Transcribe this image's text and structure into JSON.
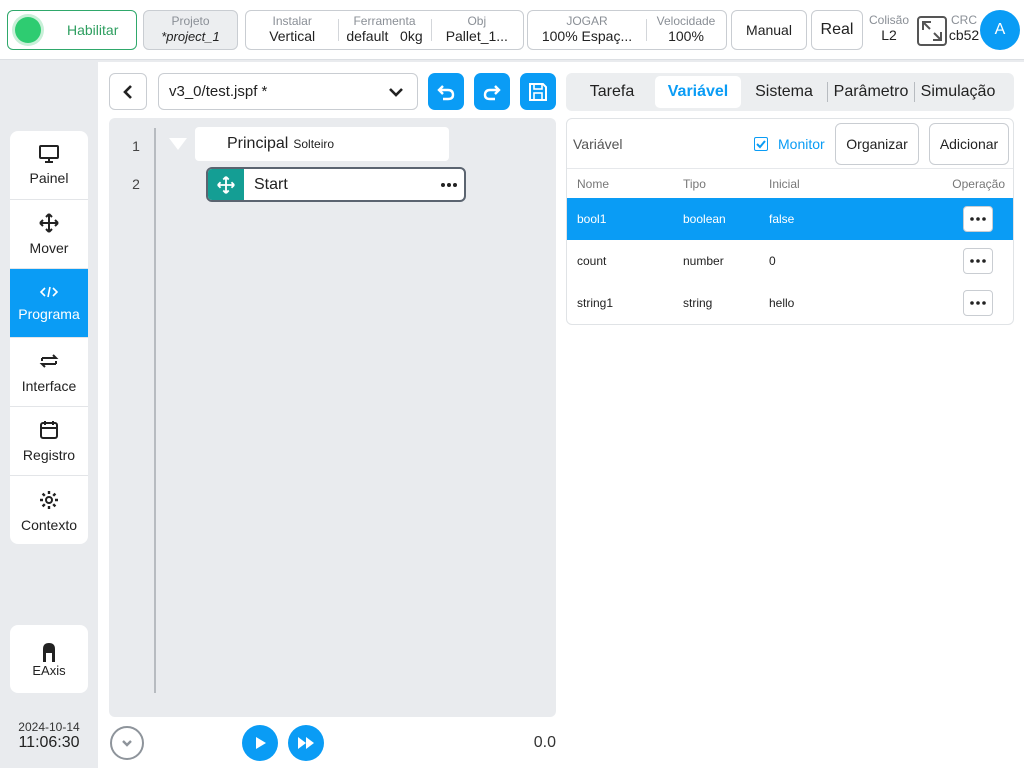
{
  "topbar": {
    "enable_label": "Habilitar",
    "project": {
      "label": "Projeto",
      "value": "*project_1"
    },
    "install": [
      {
        "label": "Instalar",
        "value": "Vertical"
      },
      {
        "label": "Ferramenta",
        "value": "default   0kg"
      },
      {
        "label": "Obj",
        "value": "Pallet_1..."
      }
    ],
    "jog": [
      {
        "label": "JOGAR",
        "value": "100%  Espaç..."
      },
      {
        "label": "Velocidade",
        "value": "100%"
      }
    ],
    "manual_label": "Manual",
    "real_label": "Real",
    "colisao": {
      "label": "Colisão",
      "value": "L2"
    },
    "crc": {
      "label": "CRC",
      "value": "cb52"
    },
    "avatar_letter": "A"
  },
  "sidebar": {
    "items": [
      {
        "label": "Painel",
        "icon": "monitor-icon"
      },
      {
        "label": "Mover",
        "icon": "move-icon"
      },
      {
        "label": "Programa",
        "icon": "code-icon"
      },
      {
        "label": "Interface",
        "icon": "swap-icon"
      },
      {
        "label": "Registro",
        "icon": "calendar-icon"
      },
      {
        "label": "Contexto",
        "icon": "gear-icon"
      }
    ],
    "active": "Programa",
    "eaxis_label": "EAxis",
    "date": "2024-10-14",
    "time": "11:06:30"
  },
  "editor": {
    "file_name": "v3_0/test.jspf *",
    "lines": [
      {
        "no": "1",
        "label": "Principal",
        "sub": "Solteiro"
      },
      {
        "no": "2",
        "label": "Start"
      }
    ],
    "speed_value": "0.0"
  },
  "tabs": {
    "items": [
      "Tarefa",
      "Variável",
      "Sistema",
      "Parâmetro",
      "Simulação"
    ],
    "active": "Variável"
  },
  "variables": {
    "title": "Variável",
    "monitor_label": "Monitor",
    "monitor_checked": true,
    "organize_label": "Organizar",
    "add_label": "Adicionar",
    "columns": {
      "name": "Nome",
      "type": "Tipo",
      "initial": "Inicial",
      "op": "Operação"
    },
    "rows": [
      {
        "name": "bool1",
        "type": "boolean",
        "initial": "false",
        "selected": true
      },
      {
        "name": "count",
        "type": "number",
        "initial": "0",
        "selected": false
      },
      {
        "name": "string1",
        "type": "string",
        "initial": "hello",
        "selected": false
      }
    ]
  },
  "colors": {
    "accent": "#0a9cf5",
    "enable": "#2ecc71",
    "start_node": "#149e94"
  }
}
